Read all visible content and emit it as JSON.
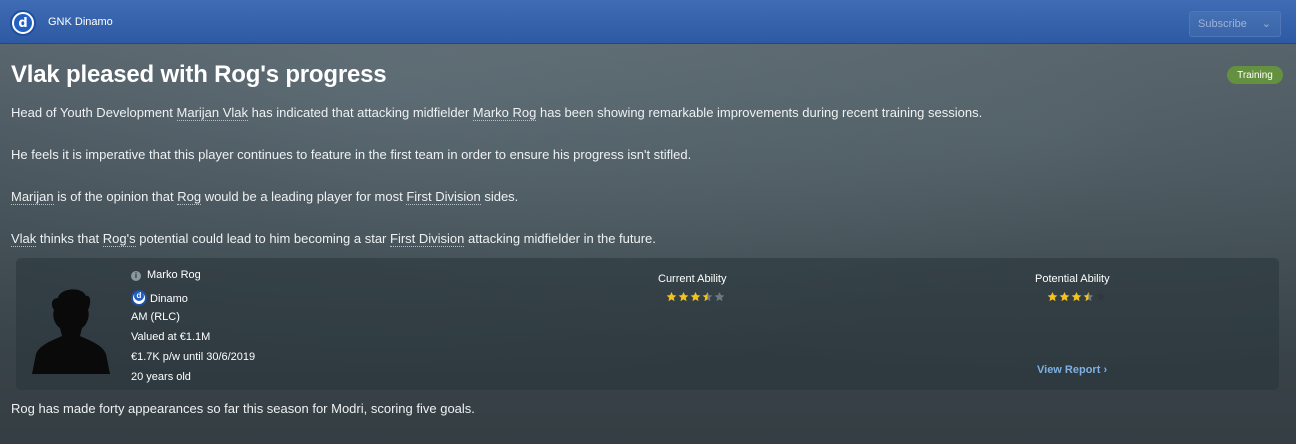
{
  "header": {
    "club_name": "GNK Dinamo",
    "badge_letter": "d",
    "subscribe_label": "Subscribe",
    "subscribe_chevron": "chevron-down-icon"
  },
  "article": {
    "title": "Vlak pleased with Rog's progress",
    "tag": "Training",
    "tag_color": "#64913f",
    "p1": {
      "a": "Head of Youth Development ",
      "link1": "Marijan Vlak",
      "b": " has indicated that attacking midfielder ",
      "link2": "Marko Rog",
      "c": " has been showing remarkable improvements during recent training sessions."
    },
    "p2": "He feels it is imperative that this player continues to feature in the first team in order to ensure his progress isn't stifled.",
    "p3": {
      "link1": "Marijan",
      "a": " is of the opinion that ",
      "link2": "Rog",
      "b": " would be a leading player for most ",
      "link3": "First Division",
      "c": " sides."
    },
    "p4": {
      "link1": "Vlak",
      "a": " thinks that ",
      "link2": "Rog's",
      "b": " potential could lead to him becoming a star ",
      "link3": "First Division",
      "c": " attacking midfielder in the future."
    },
    "closing": "Rog has made forty appearances so far this season for Modri, scoring five goals."
  },
  "player_card": {
    "name": "Marko Rog",
    "club": "Dinamo",
    "position": "AM (RLC)",
    "value": "Valued at €1.1M",
    "wage": "€1.7K p/w until 30/6/2019",
    "age": "20 years old",
    "current_ability_label": "Current Ability",
    "current_ability_stars": 3.5,
    "potential_ability_label": "Potential Ability",
    "potential_ability_stars": 3.5,
    "potential_ability_max_stars": 4,
    "view_report_label": "View Report",
    "star_color": "#f4c21a",
    "star_empty_color": "#6d7880"
  }
}
